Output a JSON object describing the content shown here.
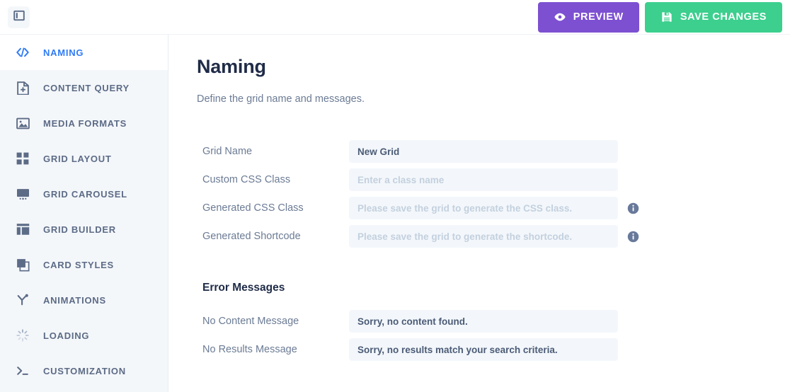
{
  "header": {
    "toggle_icon": "sidebar-toggle-icon",
    "preview_label": "PREVIEW",
    "preview_icon": "eye-icon",
    "save_label": "SAVE CHANGES",
    "save_icon": "floppy-disk-icon",
    "preview_color": "#7d50d1",
    "save_color": "#3ccf8e"
  },
  "sidebar": {
    "active_color": "#2f7bf6",
    "items": [
      {
        "label": "NAMING",
        "icon": "code-icon",
        "active": true
      },
      {
        "label": "CONTENT QUERY",
        "icon": "file-plus-icon",
        "active": false
      },
      {
        "label": "MEDIA FORMATS",
        "icon": "image-icon",
        "active": false
      },
      {
        "label": "GRID LAYOUT",
        "icon": "grid-squares-icon",
        "active": false
      },
      {
        "label": "GRID CAROUSEL",
        "icon": "monitor-icon",
        "active": false
      },
      {
        "label": "GRID BUILDER",
        "icon": "layout-panes-icon",
        "active": false
      },
      {
        "label": "CARD STYLES",
        "icon": "stacked-cards-icon",
        "active": false
      },
      {
        "label": "ANIMATIONS",
        "icon": "magic-wand-icon",
        "active": false
      },
      {
        "label": "LOADING",
        "icon": "spinner-icon",
        "active": false
      },
      {
        "label": "CUSTOMIZATION",
        "icon": "terminal-icon",
        "active": false
      }
    ]
  },
  "main": {
    "title": "Naming",
    "subtitle": "Define the grid name and messages.",
    "fields": [
      {
        "label": "Grid Name",
        "value": "New Grid",
        "placeholder": "",
        "muted": false,
        "info": false
      },
      {
        "label": "Custom CSS Class",
        "value": "",
        "placeholder": "Enter a class name",
        "muted": false,
        "info": false
      },
      {
        "label": "Generated CSS Class",
        "value": "",
        "placeholder": "Please save the grid to generate the CSS class.",
        "muted": true,
        "info": true
      },
      {
        "label": "Generated Shortcode",
        "value": "",
        "placeholder": "Please save the grid to generate the shortcode.",
        "muted": true,
        "info": true
      }
    ],
    "error_section": {
      "title": "Error Messages",
      "fields": [
        {
          "label": "No Content Message",
          "value": "Sorry, no content found.",
          "placeholder": "",
          "muted": false,
          "info": false
        },
        {
          "label": "No Results Message",
          "value": "Sorry, no results match your search criteria.",
          "placeholder": "",
          "muted": false,
          "info": false
        }
      ]
    }
  }
}
